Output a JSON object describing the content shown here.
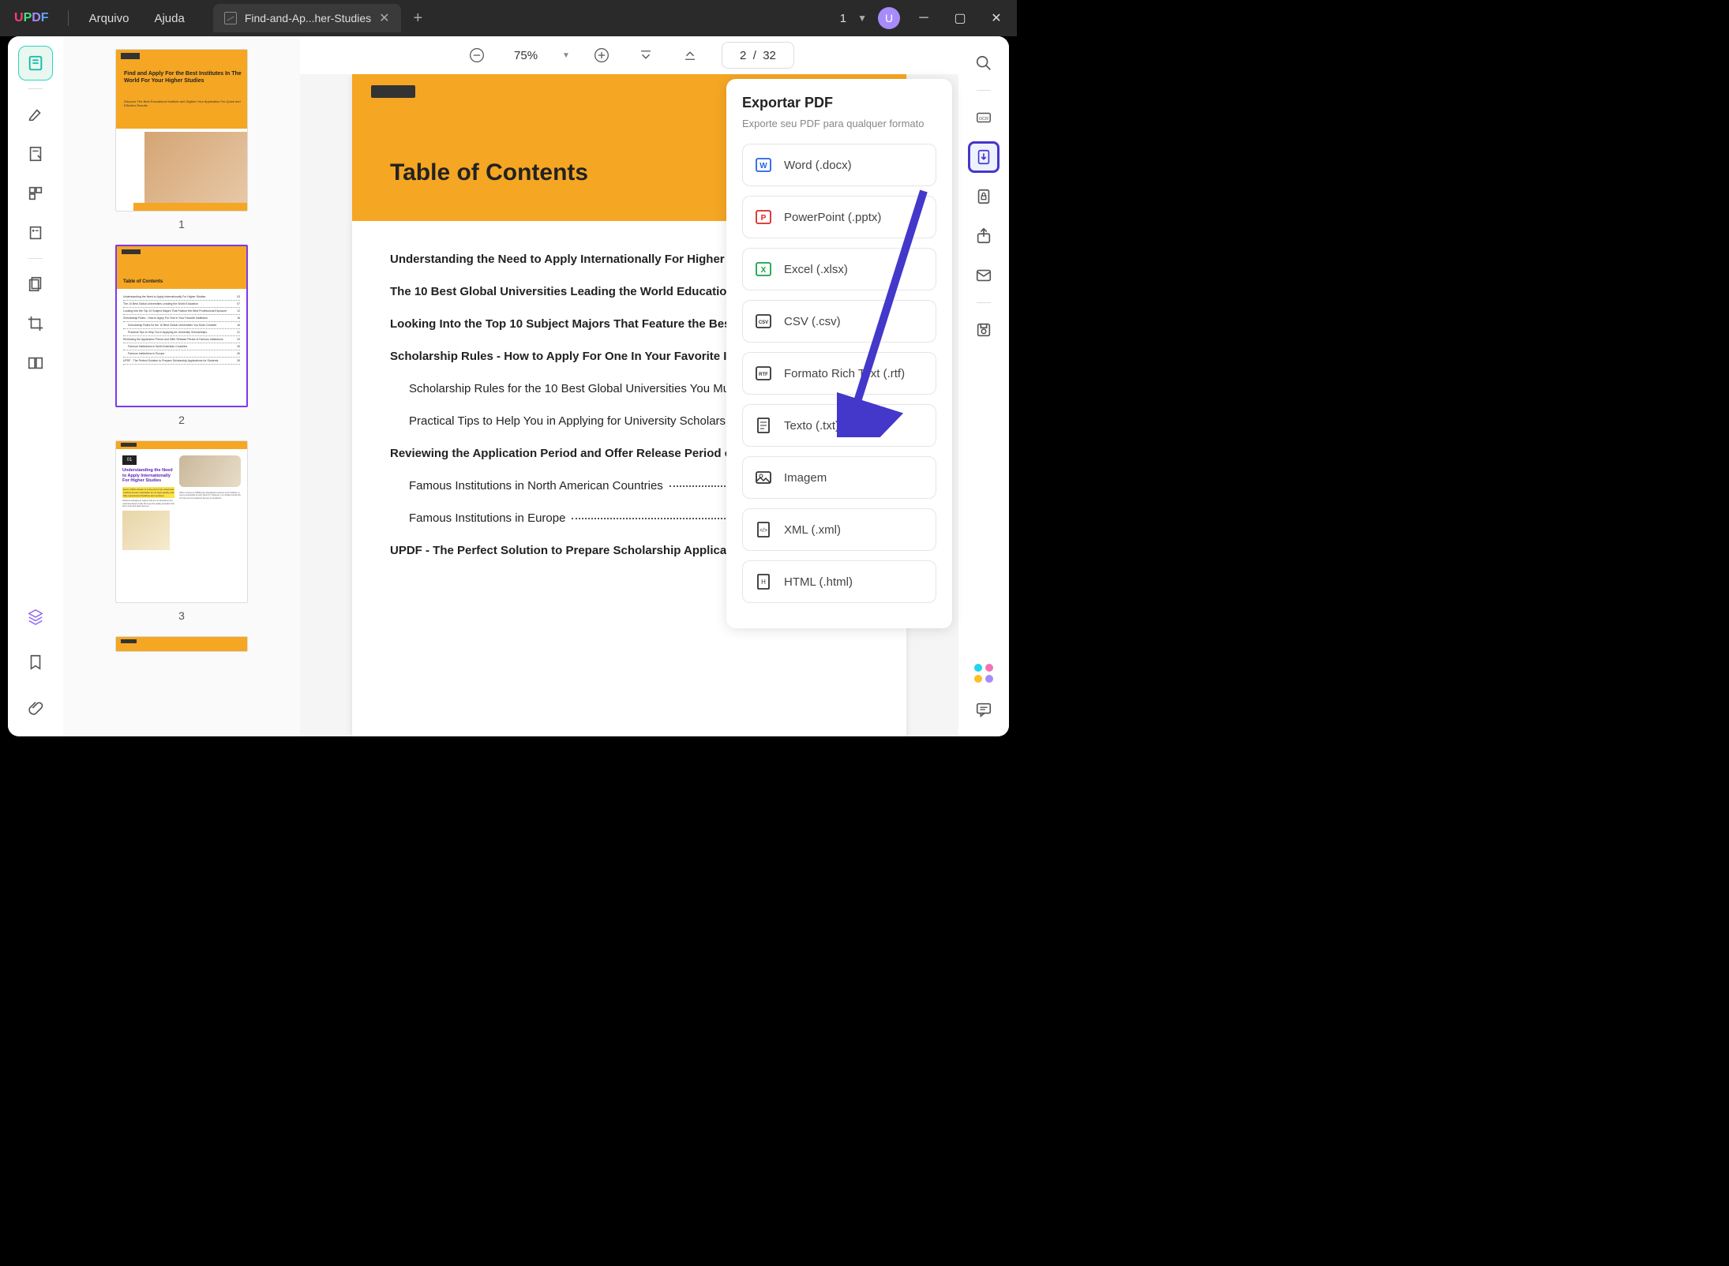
{
  "titlebar": {
    "logo": {
      "u": "U",
      "p": "P",
      "d": "D",
      "f": "F"
    },
    "menu_file": "Arquivo",
    "menu_help": "Ajuda",
    "tab_title": "Find-and-Ap...her-Studies",
    "count": "1",
    "avatar": "U"
  },
  "toolbar": {
    "zoom": "75%",
    "page_current": "2",
    "page_sep": "/",
    "page_total": "32"
  },
  "thumbs": {
    "n1": "1",
    "n2": "2",
    "n3": "3",
    "t1_title": "Find and Apply For the Best Institutes In The World For Your Higher Studies",
    "t1_sub": "Discover The Best Educational Institute and Digitize Your Application For Quick and Effective Results",
    "t2_title": "Table of Contents",
    "t3_num": "01",
    "t3_h": "Understanding the Need to Apply Internationally For Higher Studies"
  },
  "page": {
    "title": "Table of Contents",
    "toc": [
      {
        "text": "Understanding the Need to Apply Internationally For Higher Studies",
        "sub": false,
        "pg": ""
      },
      {
        "text": "The 10 Best Global Universities Leading the World Education",
        "sub": false,
        "pg": ""
      },
      {
        "text": "Looking Into the Top 10 Subject Majors That Feature the Best Professiona",
        "sub": false,
        "pg": ""
      },
      {
        "text": "Scholarship Rules - How to Apply For One In Your Favorite Institution",
        "sub": false,
        "pg": ""
      },
      {
        "text": "Scholarship Rules for the 10 Best Global Universities You Must Consider",
        "sub": true,
        "pg": ""
      },
      {
        "text": "Practical Tips to Help You in Applying for University Scholarships",
        "sub": true,
        "pg": ""
      },
      {
        "text": "Reviewing the Application Period and Offer Release Period of Famous In:",
        "sub": false,
        "pg": ""
      },
      {
        "text": "Famous Institutions in North American Countries",
        "sub": true,
        "pg": "26"
      },
      {
        "text": "Famous Institutions in Europe",
        "sub": true,
        "pg": "26"
      },
      {
        "text": "UPDF - The Perfect Solution to Prepare Scholarship Applications for Students",
        "sub": false,
        "pg": "26"
      }
    ]
  },
  "export": {
    "title": "Exportar PDF",
    "subtitle": "Exporte seu PDF para qualquer formato",
    "formats": [
      {
        "label": "Word (.docx)"
      },
      {
        "label": "PowerPoint (.pptx)"
      },
      {
        "label": "Excel (.xlsx)"
      },
      {
        "label": "CSV (.csv)"
      },
      {
        "label": "Formato Rich Text (.rtf)"
      },
      {
        "label": "Texto (.txt)"
      },
      {
        "label": "Imagem"
      },
      {
        "label": "XML (.xml)"
      },
      {
        "label": "HTML (.html)"
      }
    ]
  }
}
